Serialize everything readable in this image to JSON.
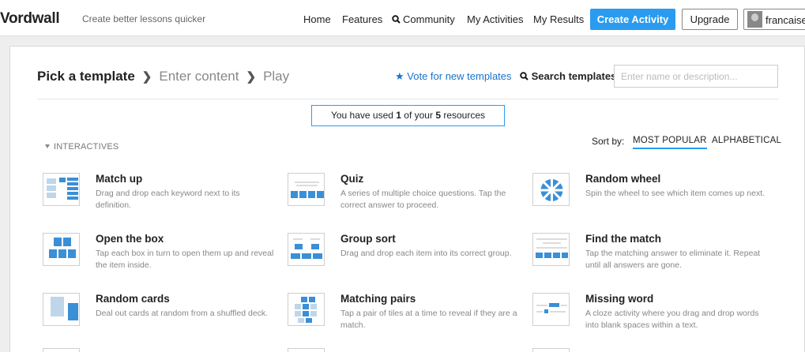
{
  "app": {
    "logo": "Vordwall",
    "tagline": "Create better lessons quicker"
  },
  "nav": {
    "home": "Home",
    "features": "Features",
    "community": "Community",
    "my_activities": "My Activities",
    "my_results": "My Results",
    "create_activity": "Create Activity",
    "upgrade": "Upgrade",
    "user": "francaise"
  },
  "steps": {
    "pick": "Pick a template",
    "enter": "Enter content",
    "play": "Play"
  },
  "vote": "Vote for new templates",
  "search": {
    "label": "Search templates:",
    "placeholder": "Enter name or description..."
  },
  "usage": {
    "prefix": "You have used ",
    "used": "1",
    "middle": " of your ",
    "total": "5",
    "suffix": " resources"
  },
  "section": "INTERACTIVES",
  "sort": {
    "label": "Sort by:",
    "popular": "MOST POPULAR",
    "alpha": "ALPHABETICAL"
  },
  "templates": [
    {
      "name": "Match up",
      "desc": "Drag and drop each keyword next to its definition."
    },
    {
      "name": "Quiz",
      "desc": "A series of multiple choice questions. Tap the correct answer to proceed."
    },
    {
      "name": "Random wheel",
      "desc": "Spin the wheel to see which item comes up next."
    },
    {
      "name": "Open the box",
      "desc": "Tap each box in turn to open them up and reveal the item inside."
    },
    {
      "name": "Group sort",
      "desc": "Drag and drop each item into its correct group."
    },
    {
      "name": "Find the match",
      "desc": "Tap the matching answer to eliminate it. Repeat until all answers are gone."
    },
    {
      "name": "Random cards",
      "desc": "Deal out cards at random from a shuffled deck."
    },
    {
      "name": "Matching pairs",
      "desc": "Tap a pair of tiles at a time to reveal if they are a match."
    },
    {
      "name": "Missing word",
      "desc": "A cloze activity where you drag and drop words into blank spaces within a text."
    }
  ],
  "colors": {
    "accent": "#2b9bef",
    "link": "#1a73c9",
    "thumb_blue": "#3a8fd6"
  }
}
